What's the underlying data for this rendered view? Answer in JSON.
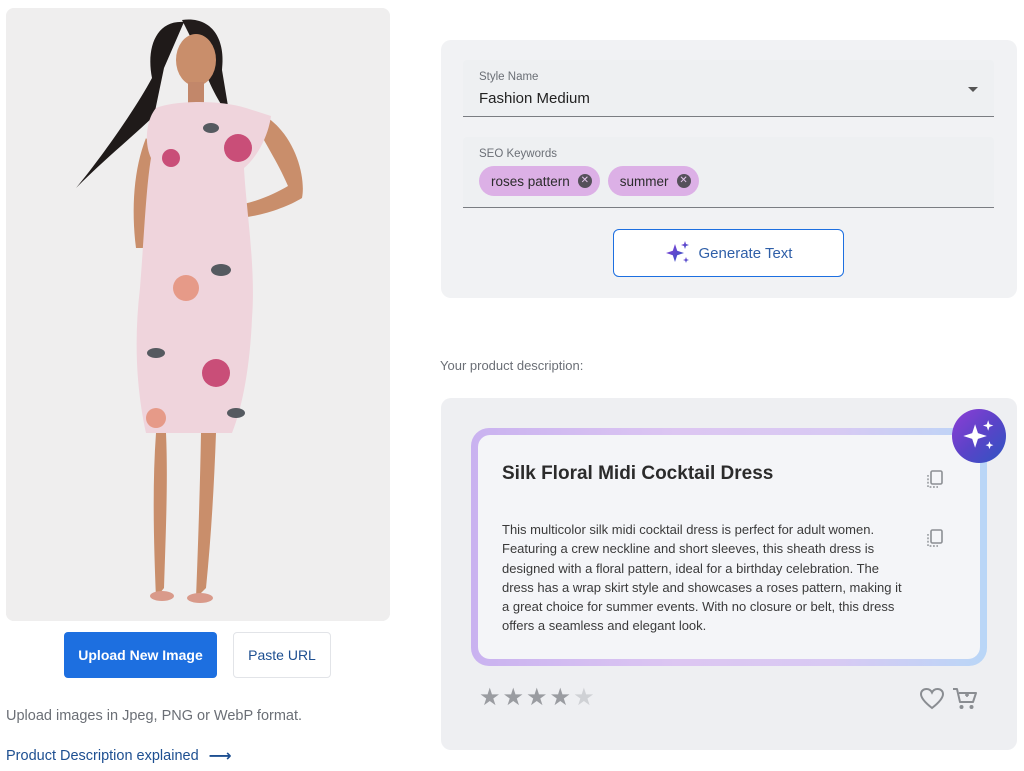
{
  "left": {
    "upload_button": "Upload New Image",
    "paste_button": "Paste URL",
    "upload_hint": "Upload images in Jpeg, PNG or WebP format.",
    "explain_link": "Product Description explained",
    "arrow": "⟶"
  },
  "form": {
    "style_label": "Style Name",
    "style_value": "Fashion Medium",
    "seo_label": "SEO Keywords",
    "keywords": [
      "roses pattern",
      "summer"
    ],
    "generate_button": "Generate Text"
  },
  "result": {
    "caption": "Your product description:",
    "title": "Silk Floral Midi Cocktail Dress",
    "description": "This multicolor silk midi cocktail dress is perfect for adult women. Featuring a crew neckline and short sleeves, this sheath dress is designed with a floral pattern, ideal for a birthday celebration. The dress has a wrap skirt style and showcases a roses pattern, making it a great choice for summer events. With no closure or belt, this dress offers a seamless and elegant look.",
    "rating": 4,
    "rating_max": 5
  },
  "colors": {
    "primary": "#1d6fe0",
    "chip": "#dcb0e6",
    "panel": "#f1f2f4"
  },
  "icons": {
    "chip_remove": "close-circle-icon",
    "generate": "sparkles-icon",
    "copy": "copy-icon",
    "favorite": "heart-icon",
    "cart": "cart-icon",
    "badge": "sparkles-icon"
  }
}
